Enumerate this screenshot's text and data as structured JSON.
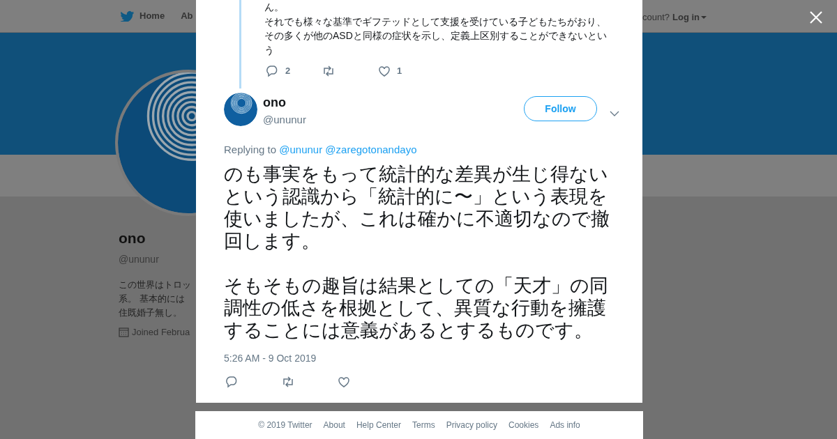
{
  "nav": {
    "items": [
      {
        "label": "Home"
      },
      {
        "label": "Ab"
      }
    ],
    "account_prompt": "count?",
    "login": "Log in"
  },
  "profile": {
    "name": "ono",
    "handle": "@ununur",
    "bio": [
      "この世界はトロッ",
      "系。 基本的には",
      "住既婚子無し。"
    ],
    "joined": "Joined Februa"
  },
  "modal": {
    "previous_tweet": {
      "paragraphs": [
        "ん。",
        "それでも様々な基準でギフテッドとして支援を受けている子どもたちがおり、その多くが他のASDと同様の症状を示し、定義上区別することができないという"
      ],
      "replies": "2",
      "likes": "1"
    },
    "tweet": {
      "name": "ono",
      "handle": "@ununur",
      "follow": "Follow",
      "replying_label": "Replying to",
      "replying_to": [
        "@ununur",
        "@zaregotonandayo"
      ],
      "paragraphs": [
        "のも事実をもって統計的な差異が生じ得ないという認識から「統計的に〜」という表現を使いましたが、これは確かに不適切なので撤回します。",
        "そもそもの趣旨は結果としての「天才」の同調性の低さを根拠として、異質な行動を擁護することには意義があるとするものです。"
      ],
      "timestamp": "5:26 AM - 9 Oct 2019"
    }
  },
  "footer": {
    "links": [
      "© 2019 Twitter",
      "About",
      "Help Center",
      "Terms",
      "Privacy policy",
      "Cookies",
      "Ads info"
    ]
  }
}
